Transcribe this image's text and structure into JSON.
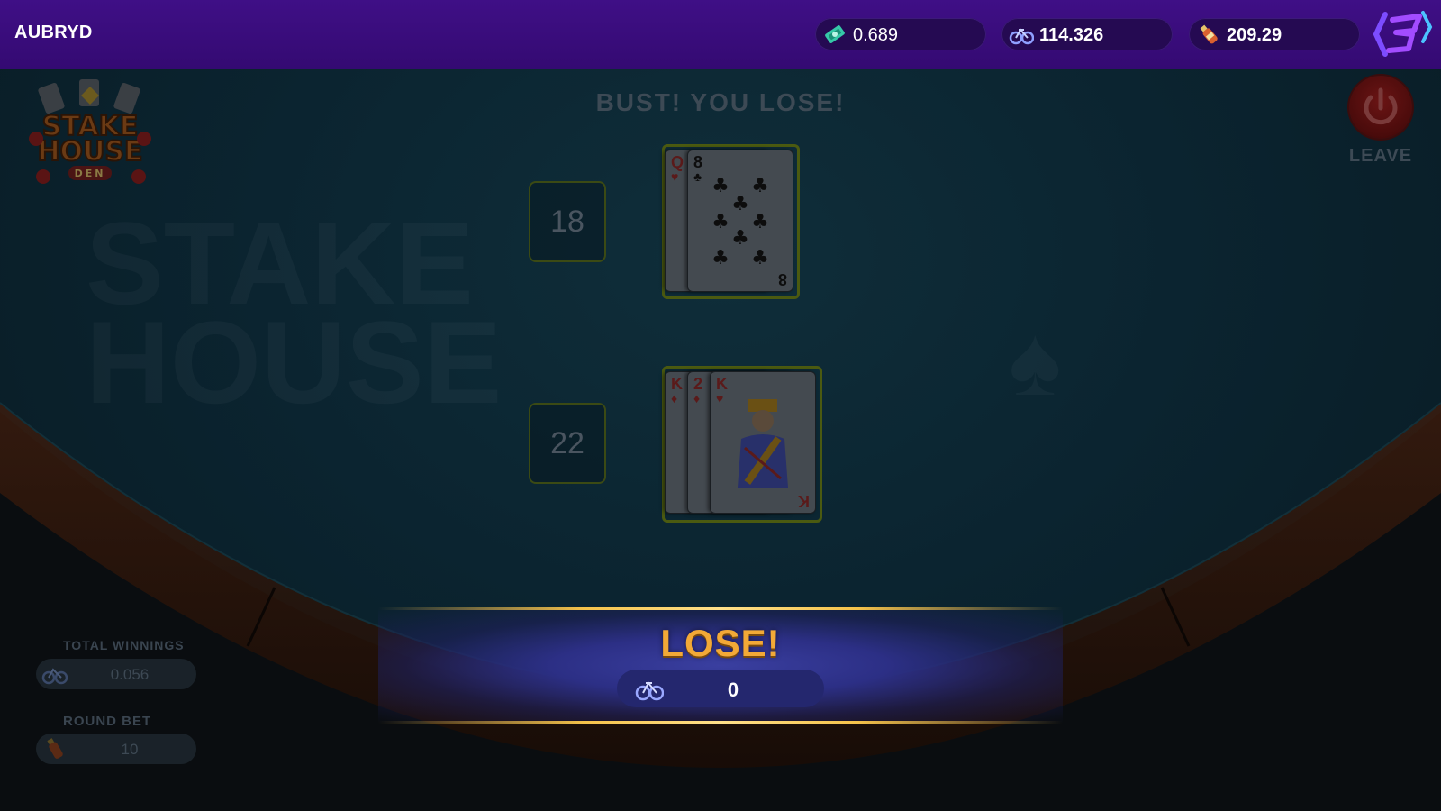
{
  "header": {
    "username": "AUBRYD",
    "balances": [
      {
        "icon": "cash-ticket-icon",
        "value": "0.689"
      },
      {
        "icon": "bicycle-token-icon",
        "value": "114.326"
      },
      {
        "icon": "bottle-token-icon",
        "value": "209.29"
      }
    ],
    "brand_logo": "brand-logo-icon"
  },
  "game": {
    "logo_text": {
      "line1": "STAKE",
      "line2": "HOUSE",
      "line3": "DEN"
    },
    "status_message": "BUST! YOU LOSE!",
    "leave_label": "LEAVE",
    "dealer": {
      "score": "18",
      "cards": [
        {
          "rank": "Q",
          "suit": "♥",
          "color": "red"
        },
        {
          "rank": "8",
          "suit": "♣",
          "color": "black"
        }
      ]
    },
    "player": {
      "score": "22",
      "cards": [
        {
          "rank": "K",
          "suit": "♦",
          "color": "red"
        },
        {
          "rank": "2",
          "suit": "♦",
          "color": "red"
        },
        {
          "rank": "K",
          "suit": "♥",
          "color": "red"
        }
      ]
    }
  },
  "result": {
    "title": "LOSE!",
    "amount": "0",
    "icon": "bicycle-token-icon"
  },
  "stats": {
    "total_winnings_label": "TOTAL WINNINGS",
    "total_winnings_value": "0.056",
    "round_bet_label": "ROUND BET",
    "round_bet_value": "10"
  },
  "colors": {
    "topbar": "#3f0f86",
    "felt": "#0b2430",
    "result_gold": "#f2a937",
    "banner_blue": "#2c2f85"
  }
}
